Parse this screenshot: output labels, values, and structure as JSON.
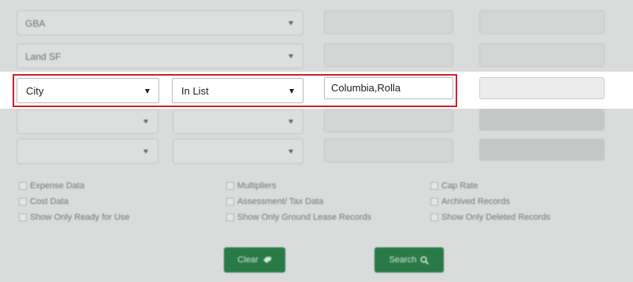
{
  "filter_rows": [
    {
      "field": "GBA"
    },
    {
      "field": "Land SF"
    },
    {
      "field": "City",
      "operator": "In List",
      "value": "Columbia,Rolla"
    },
    {
      "field": "",
      "operator": ""
    },
    {
      "field": "",
      "operator": ""
    }
  ],
  "options": [
    {
      "label": "Expense Data",
      "checked": false
    },
    {
      "label": "Cost Data",
      "checked": false
    },
    {
      "label": "Show Only Ready for Use",
      "checked": false
    },
    {
      "label": "Multipliers",
      "checked": false
    },
    {
      "label": "Assessment/ Tax Data",
      "checked": false
    },
    {
      "label": "Show Only Ground Lease Records",
      "checked": false
    },
    {
      "label": "Cap Rate",
      "checked": false
    },
    {
      "label": "Archived Records",
      "checked": false
    },
    {
      "label": "Show Only Deleted Records",
      "checked": false
    }
  ],
  "buttons": {
    "clear_label": "Clear",
    "search_label": "Search"
  },
  "icons": {
    "clear": "eraser-icon",
    "search": "search-icon"
  },
  "colors": {
    "highlight_border": "#c8232c",
    "button_green": "#2a7a47",
    "panel_gray": "#d9dcdb"
  }
}
